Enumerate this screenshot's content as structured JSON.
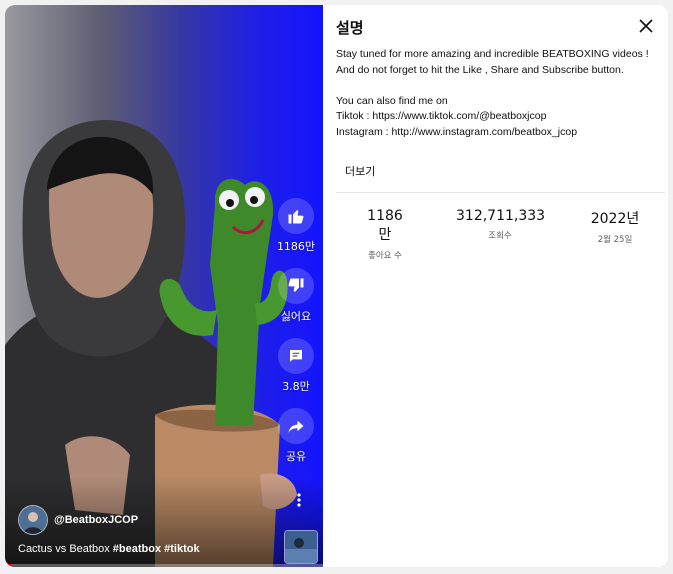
{
  "player": {
    "progress_fraction": 0.02,
    "actions": [
      {
        "icon": "thumbs-up-icon",
        "label": "1186만"
      },
      {
        "icon": "thumbs-down-icon",
        "label": "싫어요"
      },
      {
        "icon": "comment-icon",
        "label": "3.8만"
      },
      {
        "icon": "share-icon",
        "label": "공유"
      }
    ],
    "more_icon": "more-vertical-icon",
    "channel_name": "@BeatboxJCOP",
    "caption_text": "Cactus vs Beatbox ",
    "caption_tags": "#beatbox #tiktok"
  },
  "panel": {
    "title": "설명",
    "close_icon": "close-icon",
    "description_lines": [
      "Stay tuned for more amazing and incredible BEATBOXING videos !",
      "And do not forget to hit the Like , Share and Subscribe button.",
      "",
      "You can also find me on",
      "Tiktok : https://www.tiktok.com/@beatboxjcop",
      "Instagram : http://www.instagram.com/beatbox_jcop"
    ],
    "more_label": "더보기",
    "stats": [
      {
        "value": "1186만",
        "unit": "좋아요 수"
      },
      {
        "value": "312,711,333",
        "unit": "조회수"
      },
      {
        "value": "2022년",
        "unit": "2월 25일"
      }
    ]
  },
  "colors": {
    "panel_bg": "#ffffff",
    "page_bg": "#f1f1f1",
    "progress": "#ff0000",
    "backdrop_blue": "#1414ff"
  }
}
